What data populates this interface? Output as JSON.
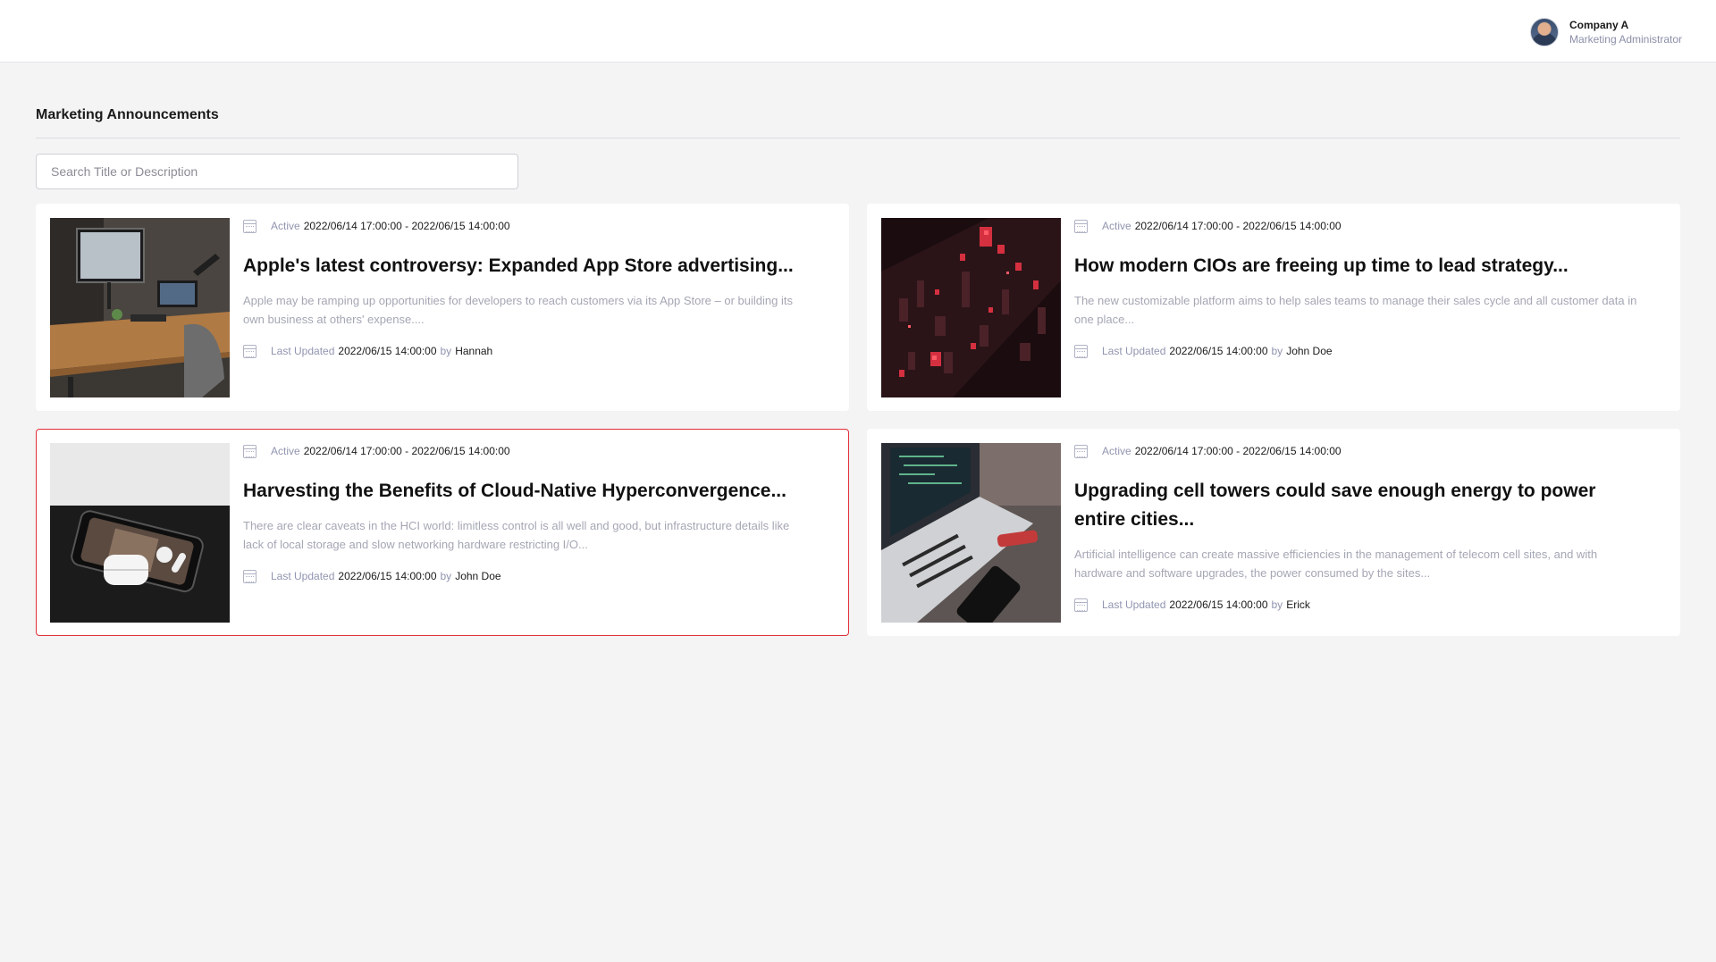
{
  "header": {
    "company": "Company A",
    "role": "Marketing Administrator"
  },
  "page": {
    "title": "Marketing Announcements",
    "search_placeholder": "Search Title or Description"
  },
  "labels": {
    "active": "Active",
    "last_updated": "Last Updated",
    "by": "by"
  },
  "announcements": [
    {
      "period": "2022/06/14 17:00:00 - 2022/06/15 14:00:00",
      "title": "Apple's latest controversy: Expanded App Store advertising...",
      "description": "Apple may be ramping up opportunities for developers to reach customers via its App Store – or building its own business at others' expense....",
      "updated": "2022/06/15 14:00:00",
      "author": "Hannah",
      "image": "desk-workspace-photo"
    },
    {
      "period": "2022/06/14 17:00:00 - 2022/06/15 14:00:00",
      "title": "How modern CIOs are freeing up time to lead strategy...",
      "description": "The new customizable platform aims to help sales teams to manage their sales cycle and all customer data in one place...",
      "updated": "2022/06/15 14:00:00",
      "author": "John Doe",
      "image": "red-data-city-render"
    },
    {
      "period": "2022/06/14 17:00:00 - 2022/06/15 14:00:00",
      "title": "Harvesting the Benefits of Cloud-Native Hyperconvergence...",
      "description": "There are clear caveats in the HCI world: limitless control is all well and good, but infrastructure details like lack of local storage and slow networking hardware restricting I/O...",
      "updated": "2022/06/15 14:00:00",
      "author": "John Doe",
      "image": "phone-earbuds-photo"
    },
    {
      "period": "2022/06/14 17:00:00 - 2022/06/15 14:00:00",
      "title": "Upgrading cell towers could save enough energy to power entire cities...",
      "description": "Artificial intelligence can create massive efficiencies in the management of telecom cell sites, and with hardware and software upgrades, the power consumed by the sites...",
      "updated": "2022/06/15 14:00:00",
      "author": "Erick",
      "image": "laptop-phone-photo"
    }
  ]
}
